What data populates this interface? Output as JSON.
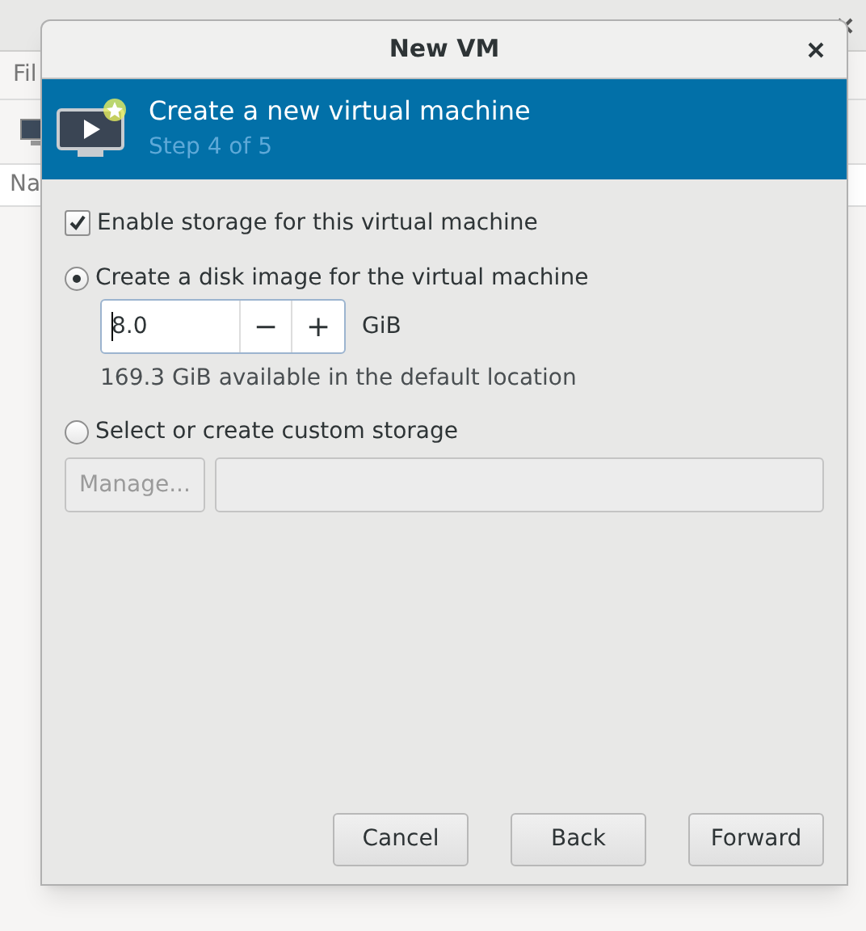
{
  "background_window": {
    "menu": "Fil",
    "column_header": "Na"
  },
  "dialog": {
    "title": "New VM",
    "banner": {
      "title": "Create a new virtual machine",
      "step": "Step 4 of 5"
    },
    "enable_storage": {
      "label": "Enable storage for this virtual machine",
      "checked": true
    },
    "options": [
      {
        "label": "Create a disk image for the virtual machine",
        "selected": true
      },
      {
        "label": "Select or create custom storage",
        "selected": false
      }
    ],
    "disk_size": {
      "value": "8.0",
      "decrement": "−",
      "increment": "+",
      "unit": "GiB"
    },
    "available": "169.3 GiB available in the default location",
    "manage_button": {
      "label": "Manage...",
      "disabled": true
    },
    "buttons": [
      {
        "label": "Cancel"
      },
      {
        "label": "Back"
      },
      {
        "label": "Forward"
      }
    ]
  }
}
